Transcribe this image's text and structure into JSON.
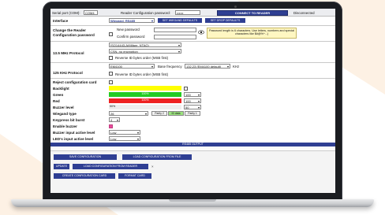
{
  "app": {
    "serial_port_label": "Serial port (COM):",
    "serial_port_value": "COM4",
    "reader_config_password_label": "Reader Configuration password:",
    "reader_config_password_value": "••••••",
    "connect_button": "CONNECT TO READER",
    "status": "Disconnected"
  },
  "interface": {
    "label": "Interface",
    "value": "Wiegand, RS485",
    "set_wiegand_defaults": "SET WIEGAND DEFAULTS",
    "set_drop_defaults": "SET DROP DEFAULTS"
  },
  "password": {
    "label": "Change the Reader Configuration password",
    "new_label": "New password",
    "confirm_label": "Confirm password",
    "note": "Password length is 6 characters. Use letters, numbers and special characters like $#@%^...)",
    "eye_icon": "eye-icon"
  },
  "protocol_13": {
    "label": "13.5 MHz Protocol",
    "value1": "ISO14443-A(Mifare, NTAG)",
    "value2": "CSN, no encryption",
    "reverse_label": "Reverse ID bytes order (MSB first)"
  },
  "protocol_125": {
    "label": "125 KHz Protocol",
    "value": "EM4100",
    "base_freq_label": "Base frequency",
    "base_freq_value": "132.23 (EM4100 default)",
    "unit": "KHz",
    "reverse_label": "Reverse ID bytes order (MSB first)"
  },
  "settings": {
    "reject_label": "Reject configuration card",
    "backlight_label": "Backlight",
    "green_label": "Green",
    "green_value_text": "100%",
    "green_num": "100",
    "red_label": "Red",
    "red_value_text": "100%",
    "red_num": "100",
    "buzzer_level_label": "Buzzer level",
    "buzzer_level_text": "50%",
    "buzzer_level_num": "50",
    "wiegand_type_label": "Wiegand type",
    "wiegand_type_value": "26",
    "parity2": "Parity 2",
    "id_data": "ID data",
    "parity1": "Parity 1",
    "keypress_label": "Keypress bit burst",
    "keypress_value": "4",
    "enable_buzzer_label": "Enable buzzer",
    "buzzer_active_label": "Buzzer input active level",
    "buzzer_active_value": "Low",
    "led_active_label": "LED's input active level",
    "led_active_value": "Low"
  },
  "output": {
    "title": "RS485 OUTPUT"
  },
  "bottom": {
    "save_config": "SAVE CONFIGURATION",
    "load_from_file": "LOAD CONFIGURATION FROM FILE",
    "update": "UPDATE",
    "load_from_reader": "LOAD CONFIGURATION FROM READER",
    "close_mark": "×",
    "create_card": "CREATE CONFIGURATION CARD",
    "format_card": "FORMAT CARD"
  },
  "colors": {
    "accent": "#2f3f93",
    "backlight": "#ffff00",
    "green": "#22cc22",
    "red": "#ee2222",
    "buzzer_bar": "#eeeeee",
    "note_bg": "#fff7c2"
  }
}
